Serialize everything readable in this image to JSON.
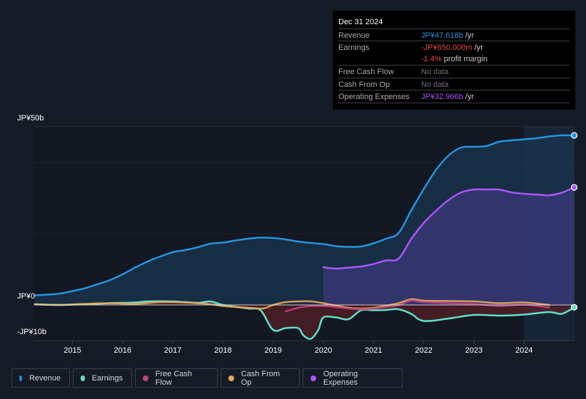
{
  "tooltip": {
    "date": "Dec 31 2024",
    "rows": [
      {
        "label": "Revenue",
        "value": "JP¥47.618b",
        "unit": " /yr",
        "color": "#2394df"
      },
      {
        "label": "Earnings",
        "value": "-JP¥650.000m",
        "unit": " /yr",
        "color": "#e64646"
      },
      {
        "label": "",
        "value": "-1.4%",
        "unit": " profit margin",
        "color": "#e64646"
      },
      {
        "label": "Free Cash Flow",
        "value": "No data",
        "unit": "",
        "color": "#6d7078"
      },
      {
        "label": "Cash From Op",
        "value": "No data",
        "unit": "",
        "color": "#6d7078"
      },
      {
        "label": "Operating Expenses",
        "value": "JP¥32.966b",
        "unit": " /yr",
        "color": "#a855f7"
      }
    ]
  },
  "legend": [
    {
      "label": "Revenue",
      "color": "#2394df"
    },
    {
      "label": "Earnings",
      "color": "#5fe0c8"
    },
    {
      "label": "Free Cash Flow",
      "color": "#c4427f"
    },
    {
      "label": "Cash From Op",
      "color": "#e8a95a"
    },
    {
      "label": "Operating Expenses",
      "color": "#a855f7"
    }
  ],
  "chart_data": {
    "type": "area",
    "title": "",
    "xlabel": "",
    "ylabel": "",
    "y_tick_labels": [
      "JP¥50b",
      "JP¥0",
      "-JP¥10b"
    ],
    "ylim": [
      -10,
      50
    ],
    "xlim": [
      2014.25,
      2025.0
    ],
    "x_ticks": [
      2015,
      2016,
      2017,
      2018,
      2019,
      2020,
      2021,
      2022,
      2023,
      2024
    ],
    "x_tick_labels": [
      "2015",
      "2016",
      "2017",
      "2018",
      "2019",
      "2020",
      "2021",
      "2022",
      "2023",
      "2024"
    ],
    "highlight_start": 2024.0,
    "units": "JP¥ billions",
    "series": [
      {
        "name": "Revenue",
        "color": "#2394df",
        "x": [
          2014.25,
          2014.5,
          2014.75,
          2015.0,
          2015.25,
          2015.5,
          2015.75,
          2016.0,
          2016.25,
          2016.5,
          2016.75,
          2017.0,
          2017.25,
          2017.5,
          2017.75,
          2018.0,
          2018.25,
          2018.5,
          2018.75,
          2019.0,
          2019.25,
          2019.5,
          2019.75,
          2020.0,
          2020.25,
          2020.5,
          2020.75,
          2021.0,
          2021.25,
          2021.5,
          2021.75,
          2022.0,
          2022.25,
          2022.5,
          2022.75,
          2023.0,
          2023.25,
          2023.5,
          2023.75,
          2024.0,
          2024.25,
          2024.5,
          2024.75,
          2025.0
        ],
        "values": [
          2.7,
          2.9,
          3.2,
          3.9,
          4.7,
          5.8,
          7.0,
          8.6,
          10.5,
          12.2,
          13.6,
          14.8,
          15.4,
          16.2,
          17.2,
          17.5,
          18.1,
          18.6,
          18.9,
          18.8,
          18.4,
          17.8,
          17.4,
          17.1,
          16.5,
          16.3,
          16.4,
          17.3,
          18.6,
          20.2,
          26.5,
          32.5,
          38.0,
          42.0,
          44.2,
          44.4,
          44.6,
          45.8,
          46.2,
          46.5,
          46.8,
          47.3,
          47.6,
          47.6
        ]
      },
      {
        "name": "Operating Expenses",
        "color": "#a855f7",
        "x": [
          2020.0,
          2020.25,
          2020.5,
          2020.75,
          2021.0,
          2021.25,
          2021.5,
          2021.75,
          2022.0,
          2022.25,
          2022.5,
          2022.75,
          2023.0,
          2023.25,
          2023.5,
          2023.75,
          2024.0,
          2024.25,
          2024.5,
          2024.75,
          2025.0
        ],
        "values": [
          10.6,
          10.2,
          10.5,
          10.8,
          11.5,
          12.5,
          13.0,
          18.5,
          23.0,
          26.5,
          29.5,
          31.6,
          32.4,
          32.4,
          32.4,
          31.6,
          31.2,
          31.0,
          30.8,
          31.5,
          33.0
        ]
      },
      {
        "name": "Earnings",
        "color": "#5fe0c8",
        "x": [
          2014.25,
          2014.75,
          2015.25,
          2015.75,
          2016.25,
          2016.5,
          2017.0,
          2017.5,
          2017.75,
          2018.0,
          2018.5,
          2018.75,
          2019.0,
          2019.25,
          2019.5,
          2019.6,
          2019.75,
          2019.9,
          2020.0,
          2020.25,
          2020.5,
          2020.75,
          2021.0,
          2021.25,
          2021.5,
          2021.75,
          2022.0,
          2022.5,
          2023.0,
          2023.5,
          2024.0,
          2024.5,
          2024.75,
          2025.0
        ],
        "values": [
          0.2,
          0.0,
          0.2,
          0.5,
          0.7,
          1.0,
          1.0,
          0.6,
          1.0,
          0.0,
          -1.0,
          -1.5,
          -7.0,
          -6.5,
          -6.5,
          -8.5,
          -9.5,
          -7.0,
          -3.5,
          -3.5,
          -4.0,
          -1.5,
          -1.5,
          -1.4,
          -1.2,
          -2.5,
          -4.5,
          -3.8,
          -2.8,
          -3.0,
          -2.7,
          -2.0,
          -2.5,
          -0.65
        ]
      },
      {
        "name": "Free Cash Flow",
        "color": "#c4427f",
        "x": [
          2019.25,
          2019.5,
          2019.75,
          2020.0,
          2020.25,
          2020.5,
          2020.75,
          2021.0,
          2021.25,
          2021.5,
          2021.75,
          2022.0,
          2022.5,
          2023.0,
          2023.5,
          2024.0,
          2024.5
        ],
        "values": [
          -1.8,
          -0.8,
          -0.3,
          -0.3,
          -0.6,
          -1.0,
          -1.2,
          -1.0,
          -0.6,
          -0.1,
          1.2,
          0.8,
          0.5,
          0.3,
          -0.3,
          0.1,
          -0.7
        ]
      },
      {
        "name": "Cash From Op",
        "color": "#e8a95a",
        "x": [
          2014.25,
          2014.75,
          2015.25,
          2015.75,
          2016.25,
          2016.75,
          2017.25,
          2017.75,
          2018.0,
          2018.5,
          2018.8,
          2019.0,
          2019.25,
          2019.5,
          2019.75,
          2020.0,
          2020.5,
          2020.75,
          2021.0,
          2021.25,
          2021.5,
          2021.75,
          2022.0,
          2022.5,
          2023.0,
          2023.5,
          2024.0,
          2024.5
        ],
        "values": [
          0.2,
          0.0,
          0.3,
          0.5,
          0.3,
          0.8,
          0.7,
          0.2,
          -0.3,
          -0.8,
          -1.0,
          0.0,
          0.8,
          1.0,
          1.0,
          0.5,
          -0.8,
          -1.0,
          -0.8,
          -0.2,
          0.5,
          1.6,
          1.2,
          1.1,
          1.0,
          0.5,
          0.7,
          0.0
        ]
      }
    ]
  }
}
